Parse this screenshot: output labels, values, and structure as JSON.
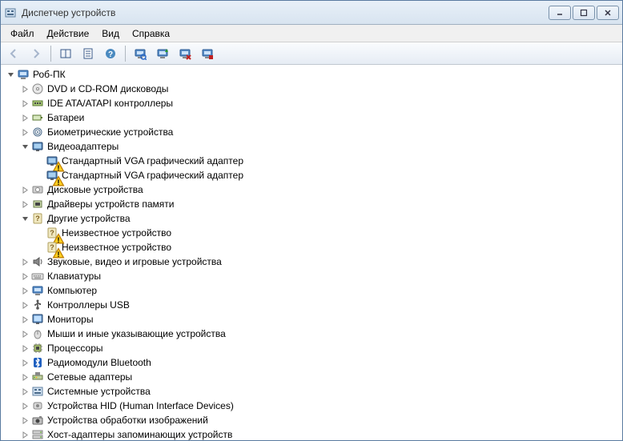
{
  "window": {
    "title": "Диспетчер устройств"
  },
  "menu": {
    "file": "Файл",
    "action": "Действие",
    "view": "Вид",
    "help": "Справка"
  },
  "tree": {
    "root": {
      "label": "Роб-ПК",
      "expanded": true,
      "icon": "computer",
      "children": [
        {
          "label": "DVD и CD-ROM дисководы",
          "icon": "disc",
          "expanded": false
        },
        {
          "label": "IDE ATA/ATAPI контроллеры",
          "icon": "ide",
          "expanded": false
        },
        {
          "label": "Батареи",
          "icon": "battery",
          "expanded": false
        },
        {
          "label": "Биометрические устройства",
          "icon": "biometric",
          "expanded": false
        },
        {
          "label": "Видеоадаптеры",
          "icon": "display",
          "expanded": true,
          "children": [
            {
              "label": "Стандартный VGA графический адаптер",
              "icon": "display",
              "warn": true
            },
            {
              "label": "Стандартный VGA графический адаптер",
              "icon": "display",
              "warn": true
            }
          ]
        },
        {
          "label": "Дисковые устройства",
          "icon": "hdd",
          "expanded": false
        },
        {
          "label": "Драйверы устройств памяти",
          "icon": "memdrv",
          "expanded": false
        },
        {
          "label": "Другие устройства",
          "icon": "unknown",
          "expanded": true,
          "children": [
            {
              "label": "Неизвестное устройство",
              "icon": "unknown",
              "warn": true
            },
            {
              "label": "Неизвестное устройство",
              "icon": "unknown",
              "warn": true
            }
          ]
        },
        {
          "label": "Звуковые, видео и игровые устройства",
          "icon": "sound",
          "expanded": false
        },
        {
          "label": "Клавиатуры",
          "icon": "keyboard",
          "expanded": false
        },
        {
          "label": "Компьютер",
          "icon": "computer",
          "expanded": false
        },
        {
          "label": "Контроллеры USB",
          "icon": "usb",
          "expanded": false
        },
        {
          "label": "Мониторы",
          "icon": "monitor",
          "expanded": false
        },
        {
          "label": "Мыши и иные указывающие устройства",
          "icon": "mouse",
          "expanded": false
        },
        {
          "label": "Процессоры",
          "icon": "cpu",
          "expanded": false
        },
        {
          "label": "Радиомодули Bluetooth",
          "icon": "bluetooth",
          "expanded": false
        },
        {
          "label": "Сетевые адаптеры",
          "icon": "network",
          "expanded": false
        },
        {
          "label": "Системные устройства",
          "icon": "system",
          "expanded": false
        },
        {
          "label": "Устройства HID (Human Interface Devices)",
          "icon": "hid",
          "expanded": false
        },
        {
          "label": "Устройства обработки изображений",
          "icon": "imaging",
          "expanded": false
        },
        {
          "label": "Хост-адаптеры запоминающих устройств",
          "icon": "storage",
          "expanded": false
        }
      ]
    }
  }
}
